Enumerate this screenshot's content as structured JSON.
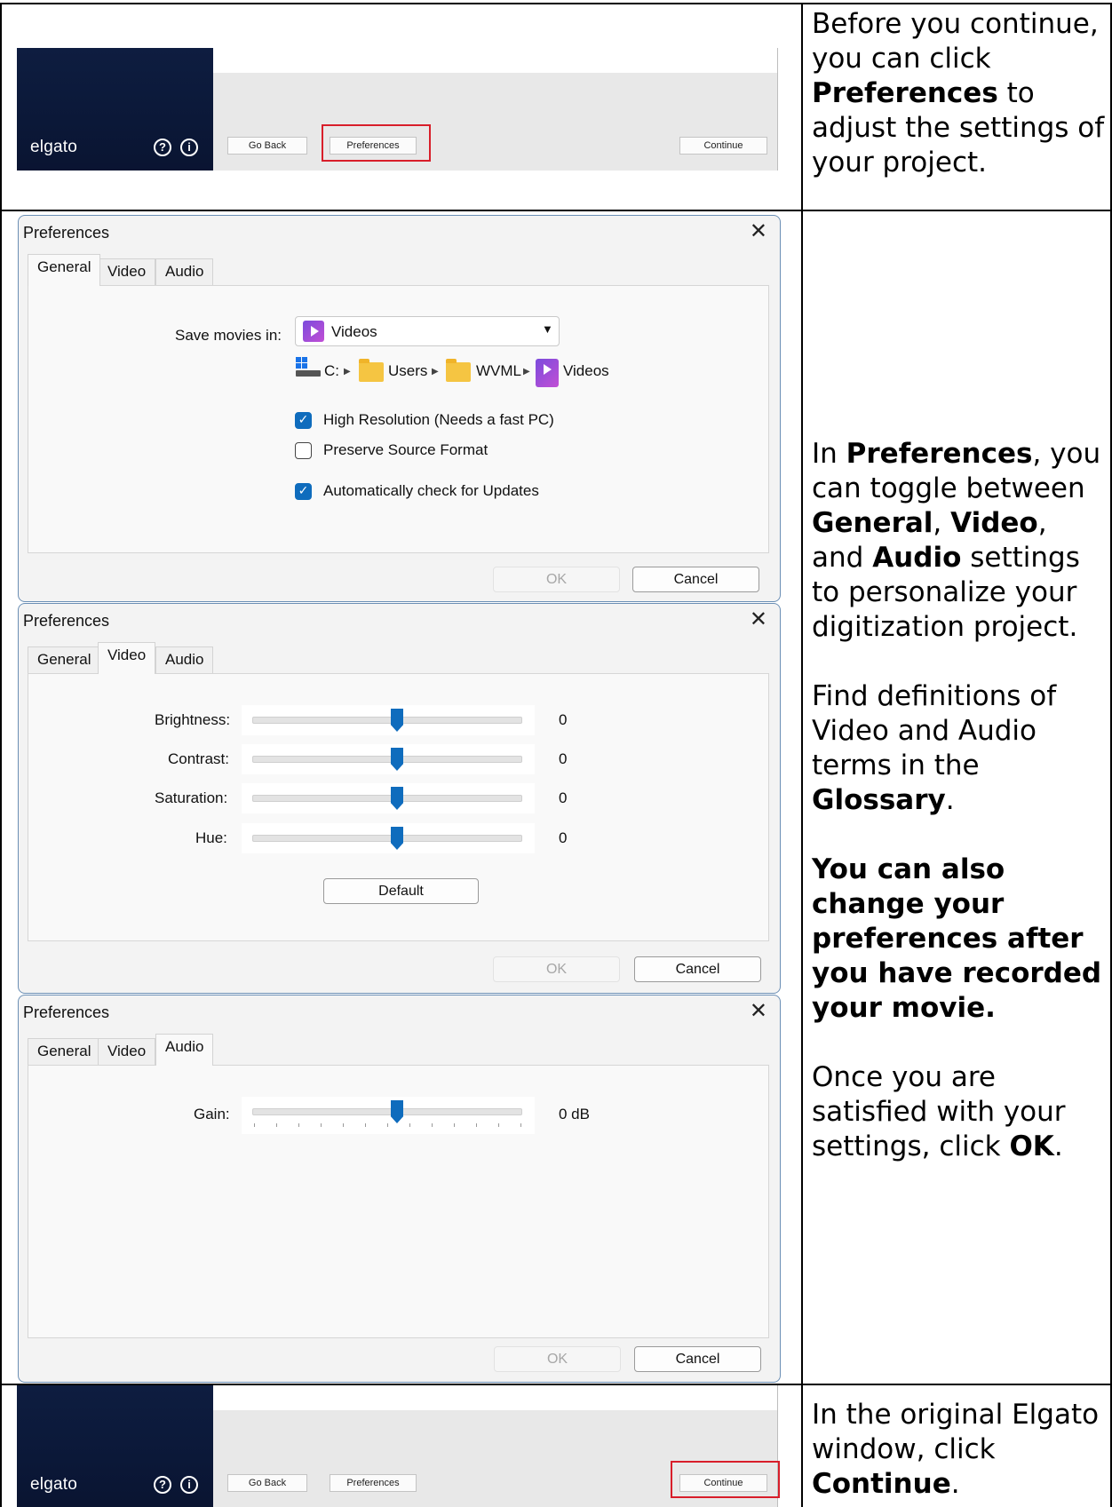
{
  "top_window": {
    "logo": "elgato",
    "help_icon": "?",
    "info_icon": "i",
    "go_back": "Go Back",
    "preferences": "Preferences",
    "continue": "Continue"
  },
  "step1_text": {
    "part1": "Before you continue, you can click ",
    "bold1": "Preferences",
    "part2": " to adjust the settings of your project."
  },
  "dialog_title": "Preferences",
  "close_glyph": "✕",
  "tabs": {
    "general": "General",
    "video": "Video",
    "audio": "Audio"
  },
  "general": {
    "save_label": "Save movies in:",
    "save_value": "Videos",
    "path": [
      "C:",
      "Users",
      "WVML",
      "Videos"
    ],
    "checkboxes": [
      {
        "label": "High Resolution (Needs a fast PC)",
        "checked": true
      },
      {
        "label": "Preserve Source Format",
        "checked": false
      },
      {
        "label": "Automatically check for Updates",
        "checked": true
      }
    ]
  },
  "video": {
    "sliders": [
      {
        "label": "Brightness:",
        "value": "0"
      },
      {
        "label": "Contrast:",
        "value": "0"
      },
      {
        "label": "Saturation:",
        "value": "0"
      },
      {
        "label": "Hue:",
        "value": "0"
      }
    ],
    "default_button": "Default"
  },
  "audio": {
    "gain_label": "Gain:",
    "gain_value": "0 dB"
  },
  "buttons": {
    "ok": "OK",
    "cancel": "Cancel"
  },
  "step2_text": {
    "p1a": "In ",
    "p1b": "Preferences",
    "p1c": ", you can toggle between ",
    "p1d": "General",
    "p1e": ", ",
    "p1f": "Video",
    "p1g": ", and ",
    "p1h": "Audio",
    "p1i": " settings to personalize your digitization project.",
    "p2a": "Find definitions of Video and Audio terms in the ",
    "p2b": "Glossary",
    "p2c": ".",
    "p3": "You can also change your preferences after you have recorded your movie.",
    "p4a": "Once you are satisfied with your settings, click ",
    "p4b": "OK",
    "p4c": "."
  },
  "step3_text": {
    "part1": "In the original Elgato window, click ",
    "bold1": "Continue",
    "part2": "."
  }
}
